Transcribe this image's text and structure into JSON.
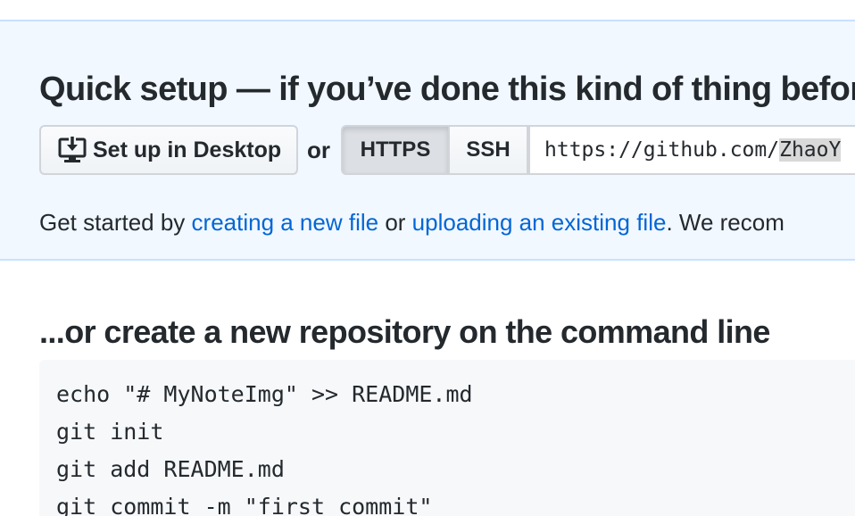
{
  "quick_setup": {
    "title": "Quick setup — if you’ve done this kind of thing before",
    "desktop_button_label": "Set up in Desktop",
    "or_label": "or",
    "protocols": [
      {
        "label": "HTTPS",
        "selected": true
      },
      {
        "label": "SSH",
        "selected": false
      }
    ],
    "clone_url_prefix": "https://github.com/",
    "clone_url_selected": "ZhaoY",
    "get_started": {
      "prefix": "Get started by ",
      "link_create": "creating a new file",
      "middle": " or ",
      "link_upload": "uploading an existing file",
      "suffix": ". We recom"
    }
  },
  "command_line": {
    "title": "...or create a new repository on the command line",
    "lines": [
      "echo \"# MyNoteImg\" >> README.md",
      "git init",
      "git add README.md",
      "git commit -m \"first commit\""
    ]
  },
  "colors": {
    "quick_setup_bg": "#f1f8ff",
    "link": "#0366d6",
    "code_bg": "#f6f8fa"
  },
  "icons": {
    "desktop": "desktop-download-icon"
  }
}
